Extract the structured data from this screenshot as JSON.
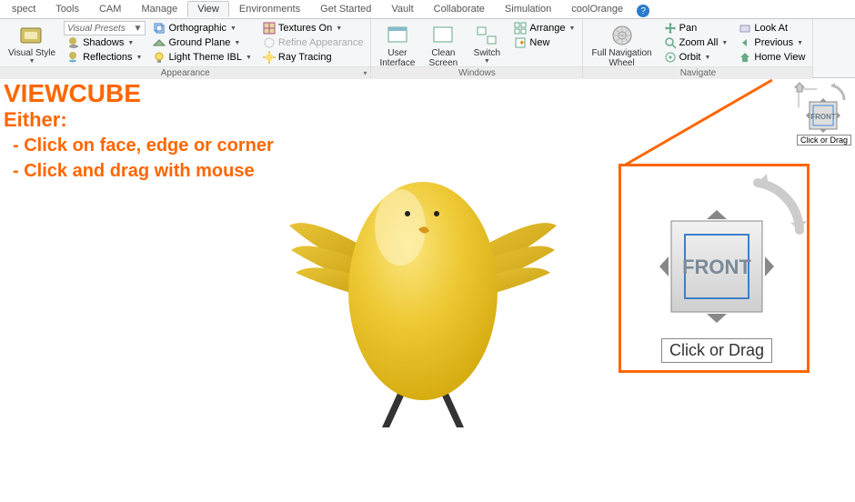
{
  "tabs": [
    "spect",
    "Tools",
    "CAM",
    "Manage",
    "View",
    "Environments",
    "Get Started",
    "Vault",
    "Collaborate",
    "Simulation",
    "coolOrange"
  ],
  "active_tab": "View",
  "help_tooltip": "?",
  "appearance": {
    "visual_style": "Visual Style",
    "presets_placeholder": "Visual Presets",
    "shadows": "Shadows",
    "reflections": "Reflections",
    "orthographic": "Orthographic",
    "ground_plane": "Ground Plane",
    "light_theme": "Light Theme IBL",
    "textures_on": "Textures On",
    "refine": "Refine Appearance",
    "ray_tracing": "Ray Tracing",
    "panel_title": "Appearance"
  },
  "windows": {
    "user_interface": "User\nInterface",
    "clean_screen": "Clean\nScreen",
    "switch": "Switch",
    "arrange": "Arrange",
    "new": "New",
    "panel_title": "Windows"
  },
  "navigate": {
    "wheel": "Full Navigation\nWheel",
    "pan": "Pan",
    "zoom_all": "Zoom All",
    "orbit": "Orbit",
    "look_at": "Look At",
    "previous": "Previous",
    "home_view": "Home View",
    "panel_title": "Navigate"
  },
  "annotation": {
    "title": "VIEWCUBE",
    "either": "Either:",
    "line1": "- Click on face, edge or corner",
    "line2": "- Click and drag with mouse"
  },
  "viewcube": {
    "face": "FRONT",
    "tooltip": "Click or Drag"
  }
}
